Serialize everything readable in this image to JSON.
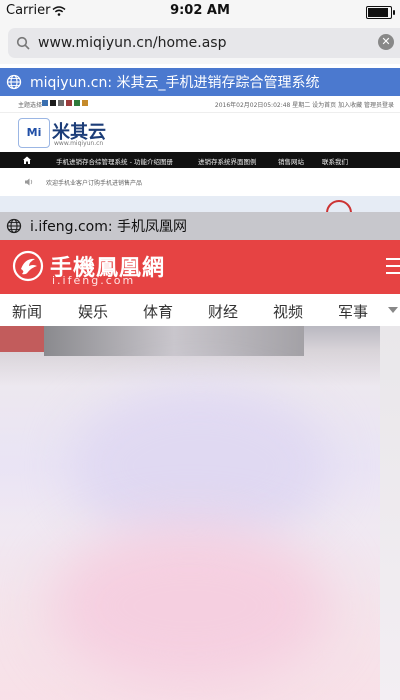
{
  "status_bar": {
    "carrier": "Carrier",
    "time": "9:02 AM",
    "battery_level": 0.9
  },
  "address_bar": {
    "url": "www.miqiyun.cn/home.asp"
  },
  "tabs": [
    {
      "domain_title": "miqiyun.cn: 米其云_手机进销存踪合管理系统",
      "page": {
        "top_label": "主题选择",
        "top_info": "2016年02月02日05:02:48 星期二   设为首页 加入收藏   管理员登录",
        "swatch_colors": [
          "#3a6fb0",
          "#1c1c1c",
          "#6b6b6b",
          "#9a3b3b",
          "#2f7a3b",
          "#c58a2a"
        ],
        "logo_mark": "Mi",
        "logo_text": "米其云",
        "logo_url": "www.miqiyun.cn",
        "nav_items": [
          "手机进销存合综管理系统 - 功能介绍图册",
          "进销存系统界面图例",
          "销售网站",
          "联系我们"
        ],
        "notice": "欢迎手机业客户订购手机进销售产品"
      }
    },
    {
      "domain_title": "i.ifeng.com: 手机凤凰网",
      "page": {
        "brand_name": "手機鳳凰網",
        "brand_domain": "i.ifeng.com",
        "categories": [
          "新闻",
          "娱乐",
          "体育",
          "财经",
          "视频",
          "军事"
        ]
      }
    }
  ],
  "colors": {
    "tab_active": "#4b79cf",
    "tab_inactive": "#c7c7cc",
    "ifeng_red": "#e64343"
  }
}
